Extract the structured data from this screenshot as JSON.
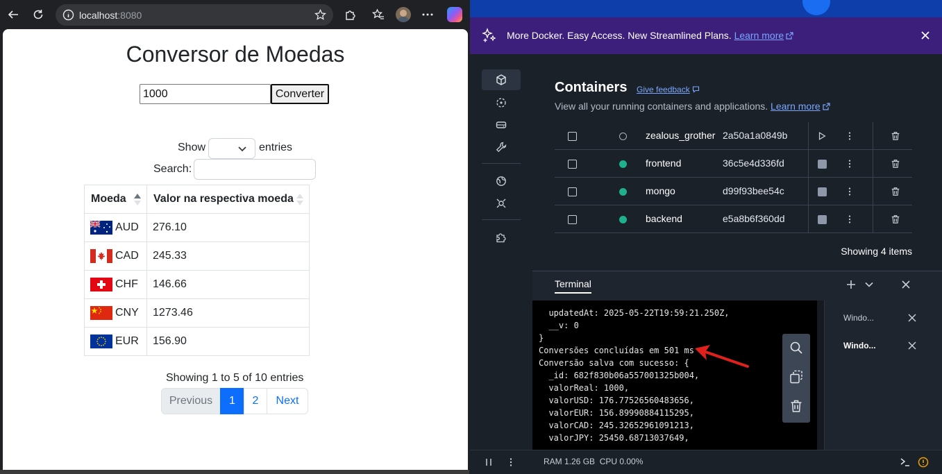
{
  "browser": {
    "url_host": "localhost",
    "url_port": ":8080"
  },
  "page": {
    "title": "Conversor de Moedas",
    "amount_value": "1000",
    "convert_label": "Converter",
    "show_label": "Show",
    "entries_label": "entries",
    "search_label": "Search:",
    "table": {
      "headers": [
        "Moeda",
        "Valor na respectiva moeda"
      ],
      "rows": [
        {
          "code": "AUD",
          "flag": "australia-flag",
          "value": "276.10"
        },
        {
          "code": "CAD",
          "flag": "canada-flag",
          "value": "245.33"
        },
        {
          "code": "CHF",
          "flag": "switzerland-flag",
          "value": "146.66"
        },
        {
          "code": "CNY",
          "flag": "china-flag",
          "value": "1273.46"
        },
        {
          "code": "EUR",
          "flag": "eu-flag",
          "value": "156.90"
        }
      ]
    },
    "info": "Showing 1 to 5 of 10 entries",
    "pagination": {
      "previous": "Previous",
      "pages": [
        "1",
        "2"
      ],
      "next": "Next",
      "current_page": "1"
    }
  },
  "docker": {
    "promo": {
      "text": "More Docker. Easy Access. New Streamlined Plans.",
      "link": "Learn more"
    },
    "containers": {
      "title": "Containers",
      "feedback": "Give feedback",
      "subtitle": "View all your running containers and applications.",
      "subtitle_link": "Learn more",
      "rows": [
        {
          "name": "zealous_grother",
          "id": "2a50a1a0849b",
          "status": "stopped"
        },
        {
          "name": "frontend",
          "id": "36c5e4d336fd",
          "status": "running"
        },
        {
          "name": "mongo",
          "id": "d99f93bee54c",
          "status": "running"
        },
        {
          "name": "backend",
          "id": "e5a8b6f360dd",
          "status": "running"
        }
      ],
      "showing": "Showing 4 items"
    },
    "terminal": {
      "tab_label": "Terminal",
      "lines": [
        "  updatedAt: 2025-05-22T19:59:21.250Z,",
        "  __v: 0",
        "}",
        "Conversões concluídas em 501 ms",
        "Conversão salva com sucesso: {",
        "  _id: 682f830b06a557001325b004,",
        "  valorReal: 1000,",
        "  valorUSD: 176.77526560483656,",
        "  valorEUR: 156.89990884115295,",
        "  valorCAD: 245.32652961091213,",
        "  valorJPY: 25450.68713037649,"
      ],
      "sessions": [
        "Windo...",
        "Windo..."
      ]
    },
    "status": {
      "ram": "RAM 1.26 GB",
      "cpu": "CPU 0.00%"
    }
  },
  "colors": {
    "accent_blue": "#0d6efd",
    "docker_promo": "#3b1f7a",
    "running_green": "#1fb08d",
    "annotation_red": "#e0201c"
  }
}
